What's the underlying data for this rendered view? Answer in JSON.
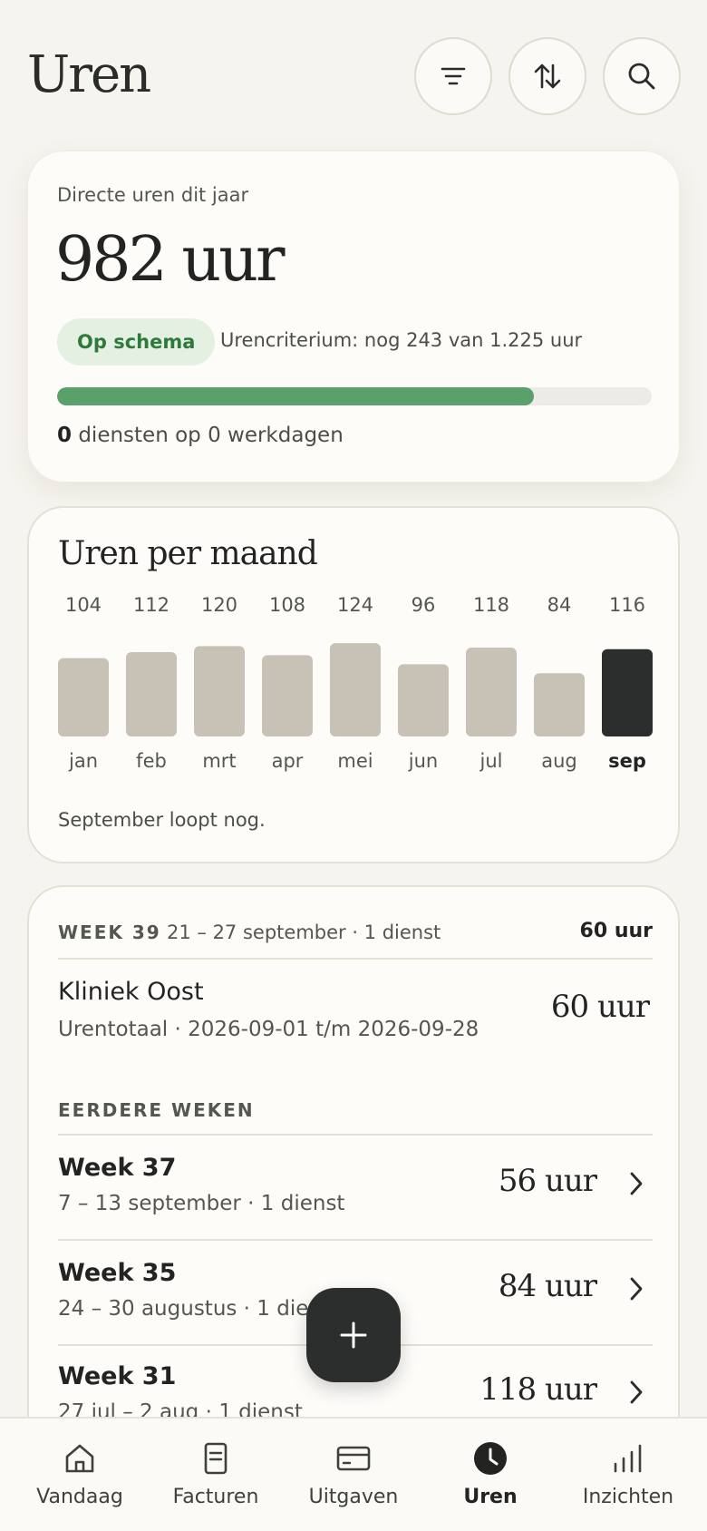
{
  "header": {
    "title": "Uren"
  },
  "summary": {
    "label": "Directe uren dit jaar",
    "value": "982 uur",
    "badge": "Op schema",
    "criterium": "Urencriterium: nog 243 van 1.225 uur",
    "progress_fraction": 0.8016,
    "diensten_count": "0",
    "diensten_text": " diensten op 0 werkdagen",
    "colors": {
      "progress": "#5aa06a",
      "badge_bg": "#e4f1e2",
      "badge_text": "#2f7a3a"
    }
  },
  "monthly": {
    "title": "Uren per maand",
    "note": "September loopt nog."
  },
  "chart_data": {
    "type": "bar",
    "categories": [
      "jan",
      "feb",
      "mrt",
      "apr",
      "mei",
      "jun",
      "jul",
      "aug",
      "sep"
    ],
    "values": [
      104,
      112,
      120,
      108,
      124,
      96,
      118,
      84,
      116
    ],
    "highlight": "sep",
    "colors": {
      "bar": "#c8c2b6",
      "highlight": "#2b2e2c"
    }
  },
  "weeks": {
    "current": {
      "label": "WEEK 39",
      "range": "21 – 27 september · 1 dienst",
      "total": "60 uur",
      "entry": {
        "title": "Kliniek Oost",
        "subtitle": "Urentotaal · 2026-09-01 t/m 2026-09-28",
        "hours": "60 uur"
      }
    },
    "earlier_label": "EERDERE WEKEN",
    "earlier": [
      {
        "title": "Week 37",
        "subtitle": "7 – 13 september · 1 dienst",
        "hours": "56 uur"
      },
      {
        "title": "Week 35",
        "subtitle": "24 – 30 augustus · 1 dienst",
        "hours": "84 uur"
      },
      {
        "title": "Week 31",
        "subtitle": "27 jul – 2 aug · 1 dienst",
        "hours": "118 uur"
      }
    ]
  },
  "nav": {
    "items": [
      {
        "label": "Vandaag",
        "icon": "home-icon"
      },
      {
        "label": "Facturen",
        "icon": "invoice-icon"
      },
      {
        "label": "Uitgaven",
        "icon": "card-icon"
      },
      {
        "label": "Uren",
        "icon": "clock-icon",
        "active": true
      },
      {
        "label": "Inzichten",
        "icon": "bars-icon"
      }
    ]
  }
}
